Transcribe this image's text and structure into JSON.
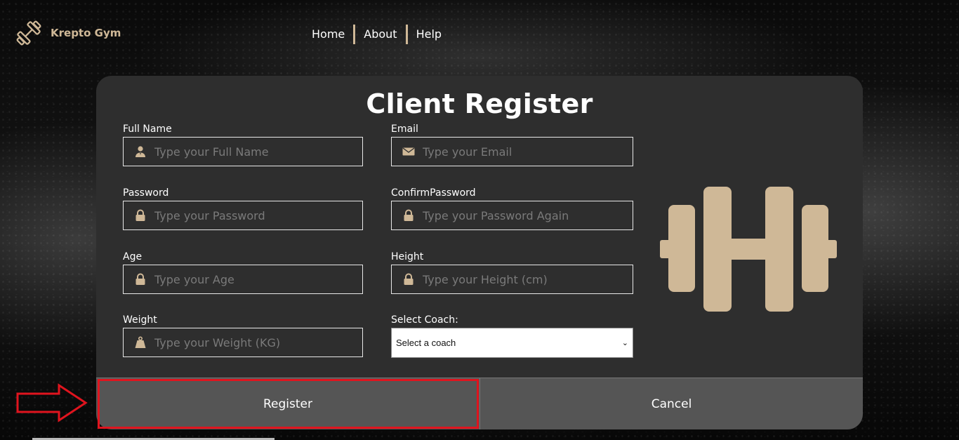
{
  "brand": {
    "name": "Krepto Gym",
    "logo_icon": "dumbbell-icon",
    "accent": "#cfb897"
  },
  "nav": [
    {
      "label": "Home"
    },
    {
      "label": "About"
    },
    {
      "label": "Help"
    }
  ],
  "form": {
    "title": "Client Register",
    "fields": {
      "full_name": {
        "label": "Full Name",
        "placeholder": "Type your Full Name",
        "icon": "user-icon"
      },
      "email": {
        "label": "Email",
        "placeholder": "Type your Email",
        "icon": "envelope-icon"
      },
      "password": {
        "label": "Password",
        "placeholder": "Type your Password",
        "icon": "lock-icon"
      },
      "confirm_password": {
        "label": "ConfirmPassword",
        "placeholder": "Type your Password Again",
        "icon": "lock-icon"
      },
      "age": {
        "label": "Age",
        "placeholder": "Type your Age",
        "icon": "lock-icon"
      },
      "height": {
        "label": "Height",
        "placeholder": "Type your Height (cm)",
        "icon": "lock-icon"
      },
      "weight": {
        "label": "Weight",
        "placeholder": "Type your Weight (KG)",
        "icon": "weight-icon"
      },
      "coach": {
        "label": "Select Coach:",
        "selected": "Select a coach"
      }
    },
    "buttons": {
      "register": "Register",
      "cancel": "Cancel"
    }
  },
  "annotation": {
    "color": "#e0141e",
    "icon": "arrow-right-icon"
  }
}
